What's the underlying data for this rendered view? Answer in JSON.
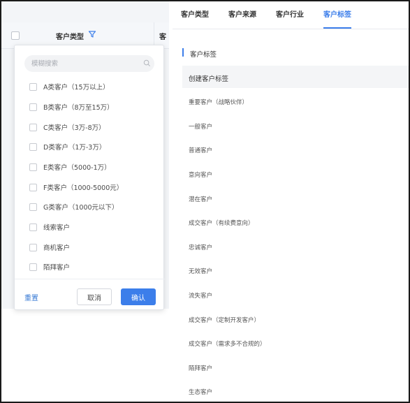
{
  "table": {
    "column_type": "客户类型",
    "column_next": "客"
  },
  "filter": {
    "search_placeholder": "模糊搜索",
    "options": [
      "A类客户（15万以上）",
      "B类客户（8万至15万）",
      "C类客户（3万-8万）",
      "D类客户（1万-3万）",
      "E类客户（5000-1万）",
      "F类客户（1000-5000元）",
      "G类客户（1000元以下）",
      "线索客户",
      "商机客户",
      "陌拜客户"
    ],
    "reset_label": "重置",
    "cancel_label": "取消",
    "confirm_label": "确认"
  },
  "tabs": [
    "客户类型",
    "客户来源",
    "客户行业",
    "客户标签"
  ],
  "active_tab": "客户标签",
  "panel": {
    "section_title": "客户标签",
    "create_label": "创建客户标签",
    "tags": [
      "重要客户（战略伙伴）",
      "一般客户",
      "普通客户",
      "意向客户",
      "潜在客户",
      "成交客户（有续费意向）",
      "忠诚客户",
      "无效客户",
      "流失客户",
      "成交客户（定制开发客户）",
      "成交客户（需求多不合规的）",
      "陌拜客户",
      "生态客户"
    ]
  },
  "colors": {
    "accent": "#3c7eea",
    "link": "#3a7bd5",
    "border": "#1a1a1a"
  }
}
